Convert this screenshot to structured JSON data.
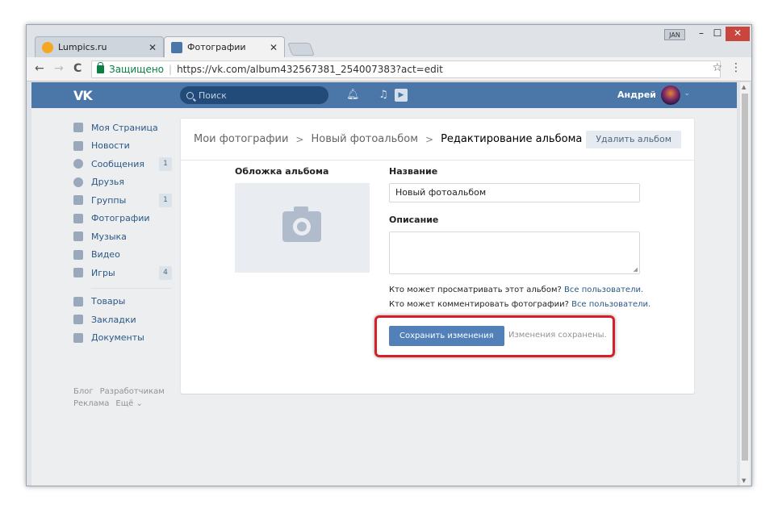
{
  "browser": {
    "tabs": [
      {
        "title": "Lumpics.ru",
        "active": false
      },
      {
        "title": "Фотографии",
        "active": true
      }
    ],
    "user_chip": "JAN",
    "window_buttons": {
      "minimize": "–",
      "maximize": "☐",
      "close": "✕"
    },
    "security_label": "Защищено",
    "url": "https://vk.com/album432567381_254007383?act=edit",
    "nav": {
      "back": "←",
      "forward": "→",
      "reload": "C"
    }
  },
  "vk": {
    "logo": "VK",
    "search_placeholder": "Поиск",
    "user_name": "Андрей",
    "menu": [
      {
        "label": "Моя Страница",
        "icon": "home-icon",
        "count": ""
      },
      {
        "label": "Новости",
        "icon": "news-icon",
        "count": ""
      },
      {
        "label": "Сообщения",
        "icon": "messages-icon",
        "count": "1"
      },
      {
        "label": "Друзья",
        "icon": "friends-icon",
        "count": ""
      },
      {
        "label": "Группы",
        "icon": "groups-icon",
        "count": "1"
      },
      {
        "label": "Фотографии",
        "icon": "camera-icon",
        "count": ""
      },
      {
        "label": "Музыка",
        "icon": "music-icon",
        "count": ""
      },
      {
        "label": "Видео",
        "icon": "video-icon",
        "count": ""
      },
      {
        "label": "Игры",
        "icon": "games-icon",
        "count": "4"
      }
    ],
    "menu2": [
      {
        "label": "Товары",
        "icon": "goods-icon"
      },
      {
        "label": "Закладки",
        "icon": "bookmarks-icon"
      },
      {
        "label": "Документы",
        "icon": "documents-icon"
      }
    ],
    "footer": {
      "blog": "Блог",
      "dev": "Разработчикам",
      "ads": "Реклама",
      "more": "Ещё ⌄"
    }
  },
  "album": {
    "breadcrumb": [
      "Мои фотографии",
      "Новый фотоальбом",
      "Редактирование альбома"
    ],
    "delete_label": "Удалить альбом",
    "cover_label": "Обложка альбома",
    "name_label": "Название",
    "name_value": "Новый фотоальбом",
    "desc_label": "Описание",
    "desc_value": "",
    "view_question": "Кто может просматривать этот альбом?",
    "view_value": "Все пользователи.",
    "comment_question": "Кто может комментировать фотографии?",
    "comment_value": "Все пользователи.",
    "save_label": "Сохранить изменения",
    "saved_message": "Изменения сохранены."
  },
  "colors": {
    "vk_blue": "#4a76a8",
    "button_blue": "#5181b8",
    "highlight_red": "#d5202a"
  }
}
